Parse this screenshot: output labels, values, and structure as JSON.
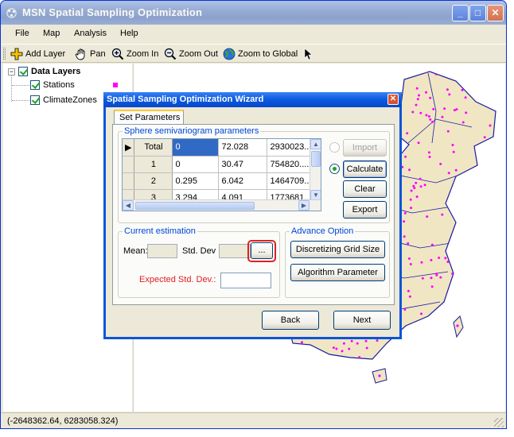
{
  "window": {
    "title": "MSN Spatial Sampling Optimization",
    "controls": {
      "minimize": "_",
      "maximize": "□",
      "close": "✕"
    }
  },
  "menu": {
    "items": [
      "File",
      "Map",
      "Analysis",
      "Help"
    ]
  },
  "toolbar": {
    "add_layer": "Add Layer",
    "pan": "Pan",
    "zoom_in": "Zoom In",
    "zoom_out": "Zoom Out",
    "zoom_global": "Zoom to Global"
  },
  "tree": {
    "root": "Data Layers",
    "layers": [
      {
        "label": "Stations",
        "color": "#ff00ff"
      },
      {
        "label": "ClimateZones"
      }
    ]
  },
  "status": {
    "coords": "(-2648362.64, 6283058.324)"
  },
  "wizard": {
    "title": "Spatial Sampling Optimization Wizard",
    "close": "✕",
    "tab": "Set Parameters",
    "semivariogram": {
      "legend": "Sphere semivariogram parameters",
      "rows": [
        {
          "label": "Total",
          "c1": "0",
          "c2": "72.028",
          "c3": "2930023...",
          "current": true
        },
        {
          "label": "1",
          "c1": "0",
          "c2": "30.47",
          "c3": "754820...."
        },
        {
          "label": "2",
          "c1": "0.295",
          "c2": "6.042",
          "c3": "1464709.."
        },
        {
          "label": "3",
          "c1": "3.294",
          "c2": "4.091",
          "c3": "1773681..."
        }
      ],
      "current_row_marker": "▶"
    },
    "options": {
      "import": "Import",
      "calculate": "Calculate",
      "clear": "Clear",
      "export": "Export"
    },
    "estimation": {
      "legend": "Current estimation",
      "mean_label": "Mean:",
      "std_label": "Std. Dev",
      "more_button": "...",
      "mean_value": "",
      "std_value": ""
    },
    "advance": {
      "legend": "Advance Option",
      "grid_size": "Discretizing Grid Size",
      "algorithm": "Algorithm Parameter"
    },
    "expected": {
      "label": "Expected Std. Dev.:",
      "value": ""
    },
    "nav": {
      "back": "Back",
      "next": "Next"
    }
  },
  "colors": {
    "accent": "#0046d5",
    "station_dot": "#ff00ff",
    "land_fill": "#f0e6c4",
    "border_line": "#1a1aa0",
    "warning_text": "#e02020"
  }
}
